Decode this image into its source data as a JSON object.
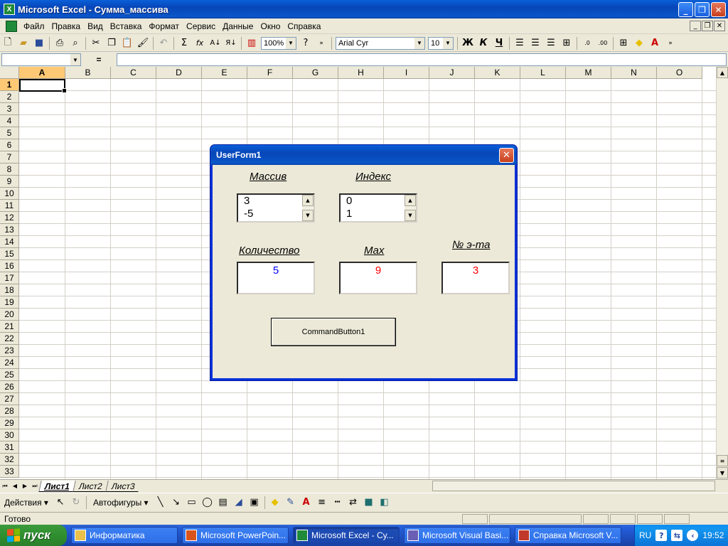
{
  "window": {
    "title": "Microsoft Excel - Сумма_массива",
    "min": "_",
    "max": "❐",
    "close": "✕"
  },
  "menu": [
    "Файл",
    "Правка",
    "Вид",
    "Вставка",
    "Формат",
    "Сервис",
    "Данные",
    "Окно",
    "Справка"
  ],
  "toolbar": {
    "zoom": "100%",
    "font": "Arial Cyr",
    "font_size": "10",
    "bold": "Ж",
    "italic": "К",
    "underline": "Ч",
    "autosum": "Σ",
    "fx": "fx"
  },
  "formula": {
    "eq": "="
  },
  "columns": [
    "A",
    "B",
    "C",
    "D",
    "E",
    "F",
    "G",
    "H",
    "I",
    "J",
    "K",
    "L",
    "M",
    "N",
    "O"
  ],
  "rows": [
    "1",
    "2",
    "3",
    "4",
    "5",
    "6",
    "7",
    "8",
    "9",
    "10",
    "11",
    "12",
    "13",
    "14",
    "15",
    "16",
    "17",
    "18",
    "19",
    "20",
    "21",
    "22",
    "23",
    "24",
    "25",
    "26",
    "27",
    "28",
    "29",
    "30",
    "31",
    "32",
    "33"
  ],
  "sheets": [
    "Лист1",
    "Лист2",
    "Лист3"
  ],
  "drawbar": {
    "actions": "Действия ▾",
    "autoshapes": "Автофигуры ▾"
  },
  "status": {
    "text": "Готово"
  },
  "taskbar": {
    "start": "пуск",
    "tasks": [
      {
        "label": "Информатика",
        "color": "#e8c04a"
      },
      {
        "label": "Microsoft PowerPoin...",
        "color": "#d9541c"
      },
      {
        "label": "Microsoft Excel - Су...",
        "color": "#1f8a3a"
      },
      {
        "label": "Microsoft Visual Basi...",
        "color": "#6b5fb5"
      },
      {
        "label": "Справка Microsoft V...",
        "color": "#c0392b"
      }
    ],
    "lang": "RU",
    "time": "19:52"
  },
  "userform": {
    "title": "UserForm1",
    "labels": {
      "array": "Массив",
      "index": "Индекс",
      "count": "Количество",
      "max": "Max",
      "element_no": "№ э-та"
    },
    "array_list": [
      "3",
      "-5"
    ],
    "index_list": [
      "0",
      "1"
    ],
    "count_value": "5",
    "max_value": "9",
    "element_value": "3",
    "button": "CommandButton1",
    "colors": {
      "count": "#0000ff",
      "max": "#ff0000",
      "element": "#ff0000"
    }
  }
}
